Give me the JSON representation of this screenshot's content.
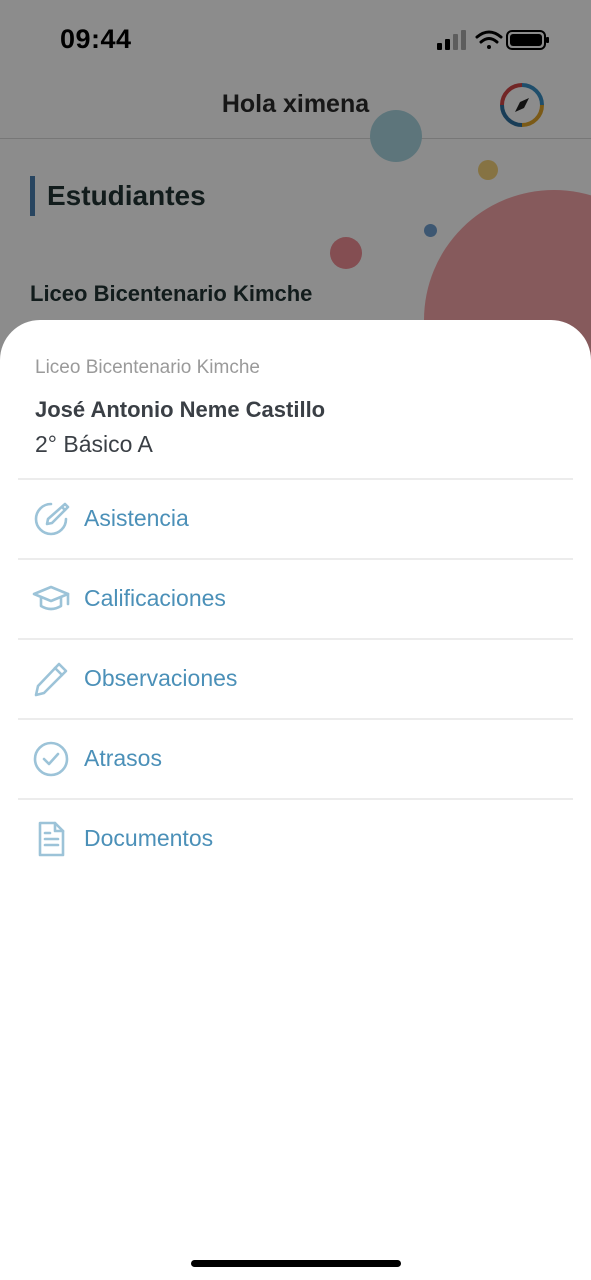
{
  "status_bar": {
    "time": "09:44"
  },
  "header": {
    "title": "Hola ximena"
  },
  "background": {
    "section_title": "Estudiantes",
    "school_name": "Liceo Bicentenario Kimche"
  },
  "sheet": {
    "school": "Liceo Bicentenario Kimche",
    "student_name": "José Antonio Neme Castillo",
    "grade": "2° Básico A",
    "items": [
      {
        "label": "Asistencia",
        "icon": "pencil-circle-icon"
      },
      {
        "label": "Calificaciones",
        "icon": "graduation-cap-icon"
      },
      {
        "label": "Observaciones",
        "icon": "pencil-icon"
      },
      {
        "label": "Atrasos",
        "icon": "check-circle-icon"
      },
      {
        "label": "Documentos",
        "icon": "document-icon"
      }
    ]
  },
  "colors": {
    "accent": "#4b90b8",
    "icon": "#9cc3d8"
  }
}
